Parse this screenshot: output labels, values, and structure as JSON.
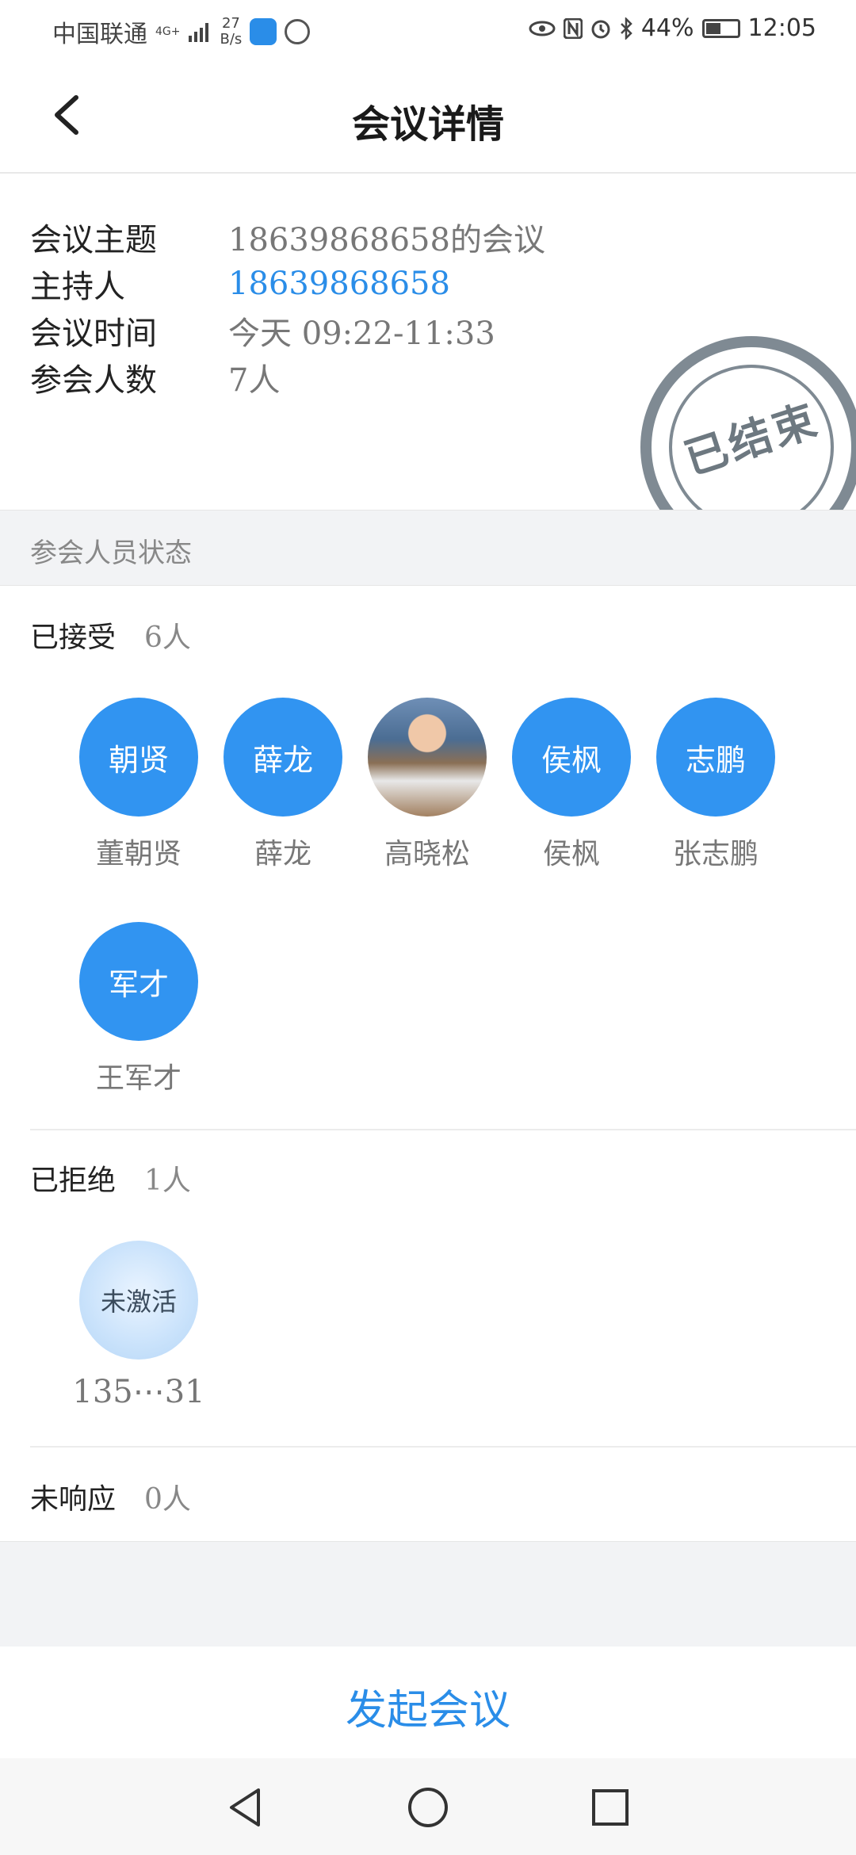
{
  "status_bar": {
    "carrier": "中国联通",
    "network": "4G+",
    "speed_value": "27",
    "speed_unit": "B/s",
    "battery": "44%",
    "time": "12:05",
    "icons": [
      "eye-icon",
      "nfc-icon",
      "alarm-icon",
      "bluetooth-icon",
      "battery-icon"
    ]
  },
  "header": {
    "title": "会议详情",
    "back_icon": "back-icon"
  },
  "info": {
    "topic_label": "会议主题",
    "topic_value": "18639868658的会议",
    "host_label": "主持人",
    "host_value": "18639868658",
    "time_label": "会议时间",
    "time_value": "今天 09:22-11:33",
    "count_label": "参会人数",
    "count_value": "7人",
    "stamp": "已结束",
    "accent_color": "#2a8de8"
  },
  "attendee_section": {
    "title": "参会人员状态",
    "accepted": {
      "label": "已接受",
      "count": "6人",
      "members": [
        {
          "avatar_text": "朝贤",
          "name": "董朝贤"
        },
        {
          "avatar_text": "薛龙",
          "name": "薛龙"
        },
        {
          "avatar_text": "",
          "name": "高晓松",
          "photo": true
        },
        {
          "avatar_text": "侯枫",
          "name": "侯枫"
        },
        {
          "avatar_text": "志鹏",
          "name": "张志鹏"
        },
        {
          "avatar_text": "军才",
          "name": "王军才"
        }
      ]
    },
    "rejected": {
      "label": "已拒绝",
      "count": "1人",
      "members": [
        {
          "avatar_text": "未激活",
          "name": "135⋯31"
        }
      ]
    },
    "no_response": {
      "label": "未响应",
      "count": "0人"
    }
  },
  "footer": {
    "start_button": "发起会议"
  },
  "nav": {
    "back": "nav-back-icon",
    "home": "nav-home-icon",
    "recent": "nav-recent-icon"
  }
}
